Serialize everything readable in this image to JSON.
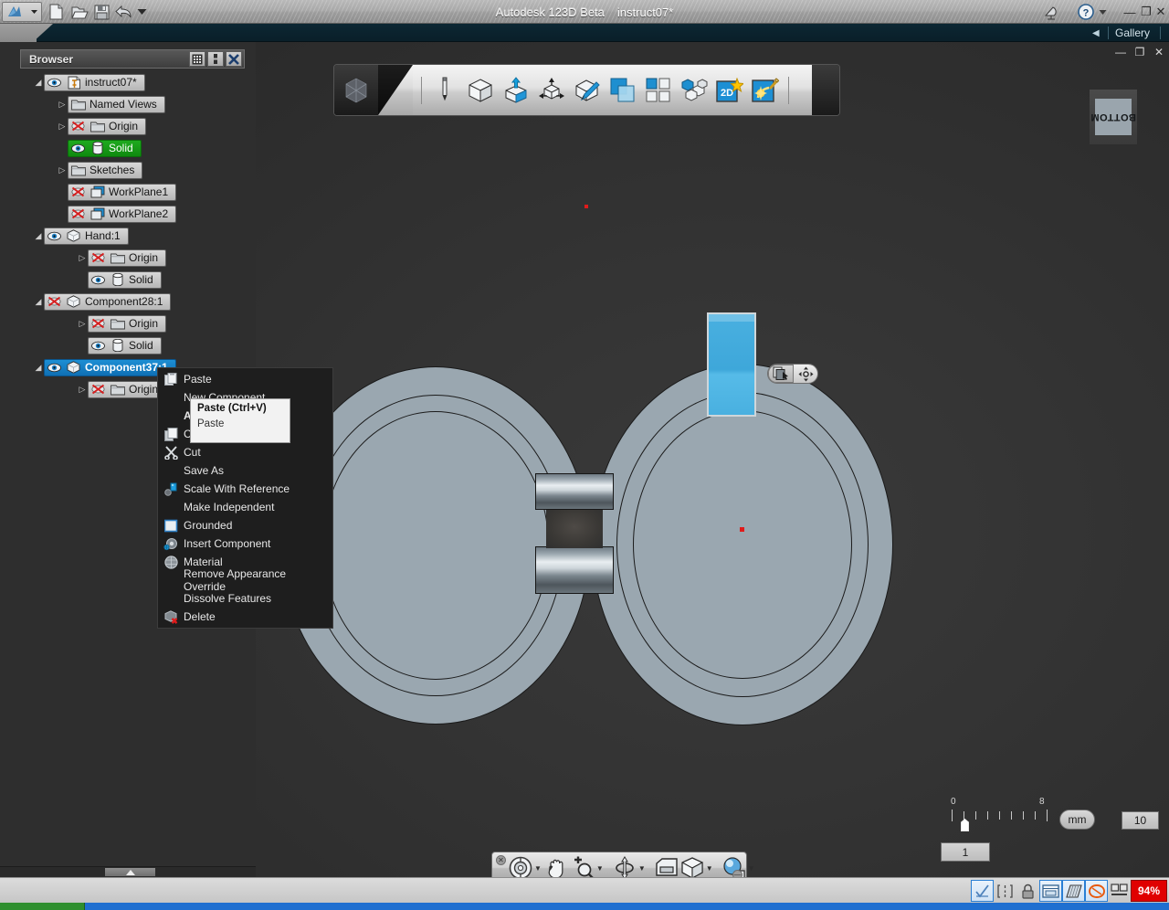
{
  "titlebar": {
    "app_name": "Autodesk 123D Beta",
    "document_name": "instruct07*",
    "quick_access": [
      {
        "name": "app-menu",
        "icon": "autodesk-logo-icon"
      },
      {
        "name": "new-file",
        "icon": "new-document-icon"
      },
      {
        "name": "open-file",
        "icon": "open-folder-icon"
      },
      {
        "name": "save-file",
        "icon": "floppy-save-icon"
      },
      {
        "name": "undo",
        "icon": "undo-arrow-icon"
      },
      {
        "name": "customize-qat",
        "icon": "chevron-down-icon"
      }
    ],
    "right_tools": [
      {
        "name": "satellite-dish",
        "icon": "satellite-icon"
      },
      {
        "name": "help",
        "icon": "help-question-icon"
      },
      {
        "name": "help-dropdown",
        "icon": "chevron-down-icon"
      }
    ],
    "window_controls": {
      "minimize": "—",
      "restore": "❐",
      "close": "✕"
    }
  },
  "gallerybar": {
    "collapse_label": "◀",
    "gallery_label": "Gallery"
  },
  "browser": {
    "title": "Browser",
    "header_buttons": [
      {
        "name": "browser-filter-button",
        "icon": "grid-filter-icon"
      },
      {
        "name": "browser-options-button",
        "icon": "vertical-dots-icon"
      },
      {
        "name": "browser-close-button",
        "icon": "close-x-icon"
      }
    ],
    "tree": [
      {
        "label": "instruct07*",
        "indent": 0,
        "arrow": "◢",
        "icons": [
          "eye-icon",
          "document-pin-icon"
        ],
        "style": "normal"
      },
      {
        "label": "Named Views",
        "indent": 1,
        "arrow": "▷",
        "icons": [
          "folder-icon"
        ],
        "style": "normal"
      },
      {
        "label": "Origin",
        "indent": 1,
        "arrow": "▷",
        "icons": [
          "eye-off-icon",
          "folder-icon"
        ],
        "style": "normal"
      },
      {
        "label": "Solid",
        "indent": 1,
        "arrow": "",
        "icons": [
          "eye-icon",
          "cylinder-icon"
        ],
        "style": "green"
      },
      {
        "label": "Sketches",
        "indent": 1,
        "arrow": "▷",
        "icons": [
          "folder-icon"
        ],
        "style": "normal"
      },
      {
        "label": "WorkPlane1",
        "indent": 1,
        "arrow": "",
        "icons": [
          "eye-off-icon",
          "workplane-icon"
        ],
        "style": "normal"
      },
      {
        "label": "WorkPlane2",
        "indent": 1,
        "arrow": "",
        "icons": [
          "eye-off-icon",
          "workplane-icon"
        ],
        "style": "normal"
      },
      {
        "label": "Hand:1",
        "indent": 0,
        "arrow": "◢",
        "icons": [
          "eye-icon",
          "cube-icon"
        ],
        "style": "normal"
      },
      {
        "label": "Origin",
        "indent": 2,
        "arrow": "▷",
        "icons": [
          "eye-off-icon",
          "folder-icon"
        ],
        "style": "normal"
      },
      {
        "label": "Solid",
        "indent": 2,
        "arrow": "",
        "icons": [
          "eye-icon",
          "cylinder-icon"
        ],
        "style": "normal"
      },
      {
        "label": "Component28:1",
        "indent": 0,
        "arrow": "◢",
        "icons": [
          "eye-off-icon",
          "cube-icon"
        ],
        "style": "normal"
      },
      {
        "label": "Origin",
        "indent": 2,
        "arrow": "▷",
        "icons": [
          "eye-off-icon",
          "folder-icon"
        ],
        "style": "normal"
      },
      {
        "label": "Solid",
        "indent": 2,
        "arrow": "",
        "icons": [
          "eye-icon",
          "cylinder-icon"
        ],
        "style": "normal"
      },
      {
        "label": "Component37:1",
        "indent": 0,
        "arrow": "◢",
        "icons": [
          "eye-icon",
          "cube-icon"
        ],
        "style": "blue"
      },
      {
        "label": "Origin",
        "indent": 2,
        "arrow": "▷",
        "icons": [
          "eye-off-icon",
          "folder-icon"
        ],
        "style": "normal"
      }
    ]
  },
  "toolbar": {
    "items": [
      {
        "name": "sketch-pencil-tool",
        "icon": "pencil-icon"
      },
      {
        "name": "primitive-box-tool",
        "icon": "cube-outline-icon"
      },
      {
        "name": "extrude-tool",
        "icon": "cube-extrude-icon"
      },
      {
        "name": "transform-tool",
        "icon": "cube-arrows-icon"
      },
      {
        "name": "modify-tool",
        "icon": "cube-pencil-icon"
      },
      {
        "name": "combine-tool",
        "icon": "two-squares-icon"
      },
      {
        "name": "pattern-tool",
        "icon": "four-squares-icon"
      },
      {
        "name": "assembly-tool",
        "icon": "cube-group-icon"
      },
      {
        "name": "construct-2d-tool",
        "icon": "2d-star-icon"
      },
      {
        "name": "smart-tool",
        "icon": "magic-wand-icon"
      }
    ],
    "cube_badge": "cube-logo-icon"
  },
  "viewcube": {
    "face_label": "BOTTOM"
  },
  "context_menu": {
    "items": [
      {
        "label": "Paste",
        "icon": "paste-icon",
        "bold": false
      },
      {
        "label": "New Component",
        "icon": "",
        "bold": false
      },
      {
        "label": "Activate",
        "icon": "",
        "bold": true
      },
      {
        "label": "Copy",
        "icon": "copy-icon",
        "bold": false
      },
      {
        "label": "Cut",
        "icon": "scissors-icon",
        "bold": false
      },
      {
        "label": "Save As",
        "icon": "",
        "bold": false
      },
      {
        "label": "Scale With Reference",
        "icon": "scale-ref-icon",
        "bold": false
      },
      {
        "label": "Make Independent",
        "icon": "",
        "bold": false
      },
      {
        "label": "Grounded",
        "icon": "checkbox-icon",
        "bold": false
      },
      {
        "label": "Insert Component",
        "icon": "insert-component-icon",
        "bold": false
      },
      {
        "label": "Material",
        "icon": "material-sphere-icon",
        "bold": false
      },
      {
        "label": "Remove Appearance Override",
        "icon": "",
        "bold": false
      },
      {
        "label": "Dissolve Features",
        "icon": "",
        "bold": false
      },
      {
        "label": "Delete",
        "icon": "delete-cube-icon",
        "bold": false
      }
    ]
  },
  "tooltip": {
    "title": "Paste (Ctrl+V)",
    "body": "Paste"
  },
  "mini_toolbar": {
    "buttons": [
      {
        "name": "copy-handle-button",
        "icon": "copy-cursor-icon"
      },
      {
        "name": "move-handle-button",
        "icon": "move-arrows-icon"
      }
    ]
  },
  "navbar": {
    "tools": [
      {
        "name": "steering-wheel-tool",
        "icon": "steering-wheel-icon",
        "has_arrow": true
      },
      {
        "name": "pan-tool",
        "icon": "hand-pan-icon",
        "has_arrow": false
      },
      {
        "name": "zoom-tool",
        "icon": "zoom-plus-icon",
        "has_arrow": true
      },
      {
        "name": "orbit-tool",
        "icon": "orbit-icon",
        "has_arrow": true
      },
      {
        "name": "look-at-tool",
        "icon": "camera-view-icon",
        "has_arrow": false
      },
      {
        "name": "view-cube-tool",
        "icon": "cube-view-icon",
        "has_arrow": true
      },
      {
        "name": "scene-light-tool",
        "icon": "light-sphere-icon",
        "has_arrow": true
      }
    ],
    "close_label": "✕",
    "minimize_label": "—"
  },
  "ruler": {
    "min_label": "0",
    "max_label": "8",
    "unit": "mm",
    "value_left": "1",
    "value_right": "10"
  },
  "statusbar": {
    "icons": [
      {
        "name": "snap-toggle",
        "icon": "check-angle-icon",
        "active": true
      },
      {
        "name": "constraint-toggle",
        "icon": "bracket-dash-icon",
        "active": false
      },
      {
        "name": "lock-toggle",
        "icon": "padlock-icon",
        "active": false
      },
      {
        "name": "dimension-toggle",
        "icon": "dimension-icon",
        "active": true
      },
      {
        "name": "grid-toggle",
        "icon": "grid-plane-icon",
        "active": true
      },
      {
        "name": "shape-toggle",
        "icon": "orange-loop-icon",
        "active": true
      },
      {
        "name": "display-toggle",
        "icon": "two-panels-icon",
        "active": false
      }
    ],
    "progress_badge": "94%",
    "badge_color": "#e00000"
  },
  "colors": {
    "accent_blue": "#1d8fd4",
    "selection_blue": "#49b0e0",
    "active_green": "#1faa1f",
    "alert_red": "#e00000",
    "model_grey": "#9aa7b0",
    "canvas_bg": "#2e2e2e"
  }
}
